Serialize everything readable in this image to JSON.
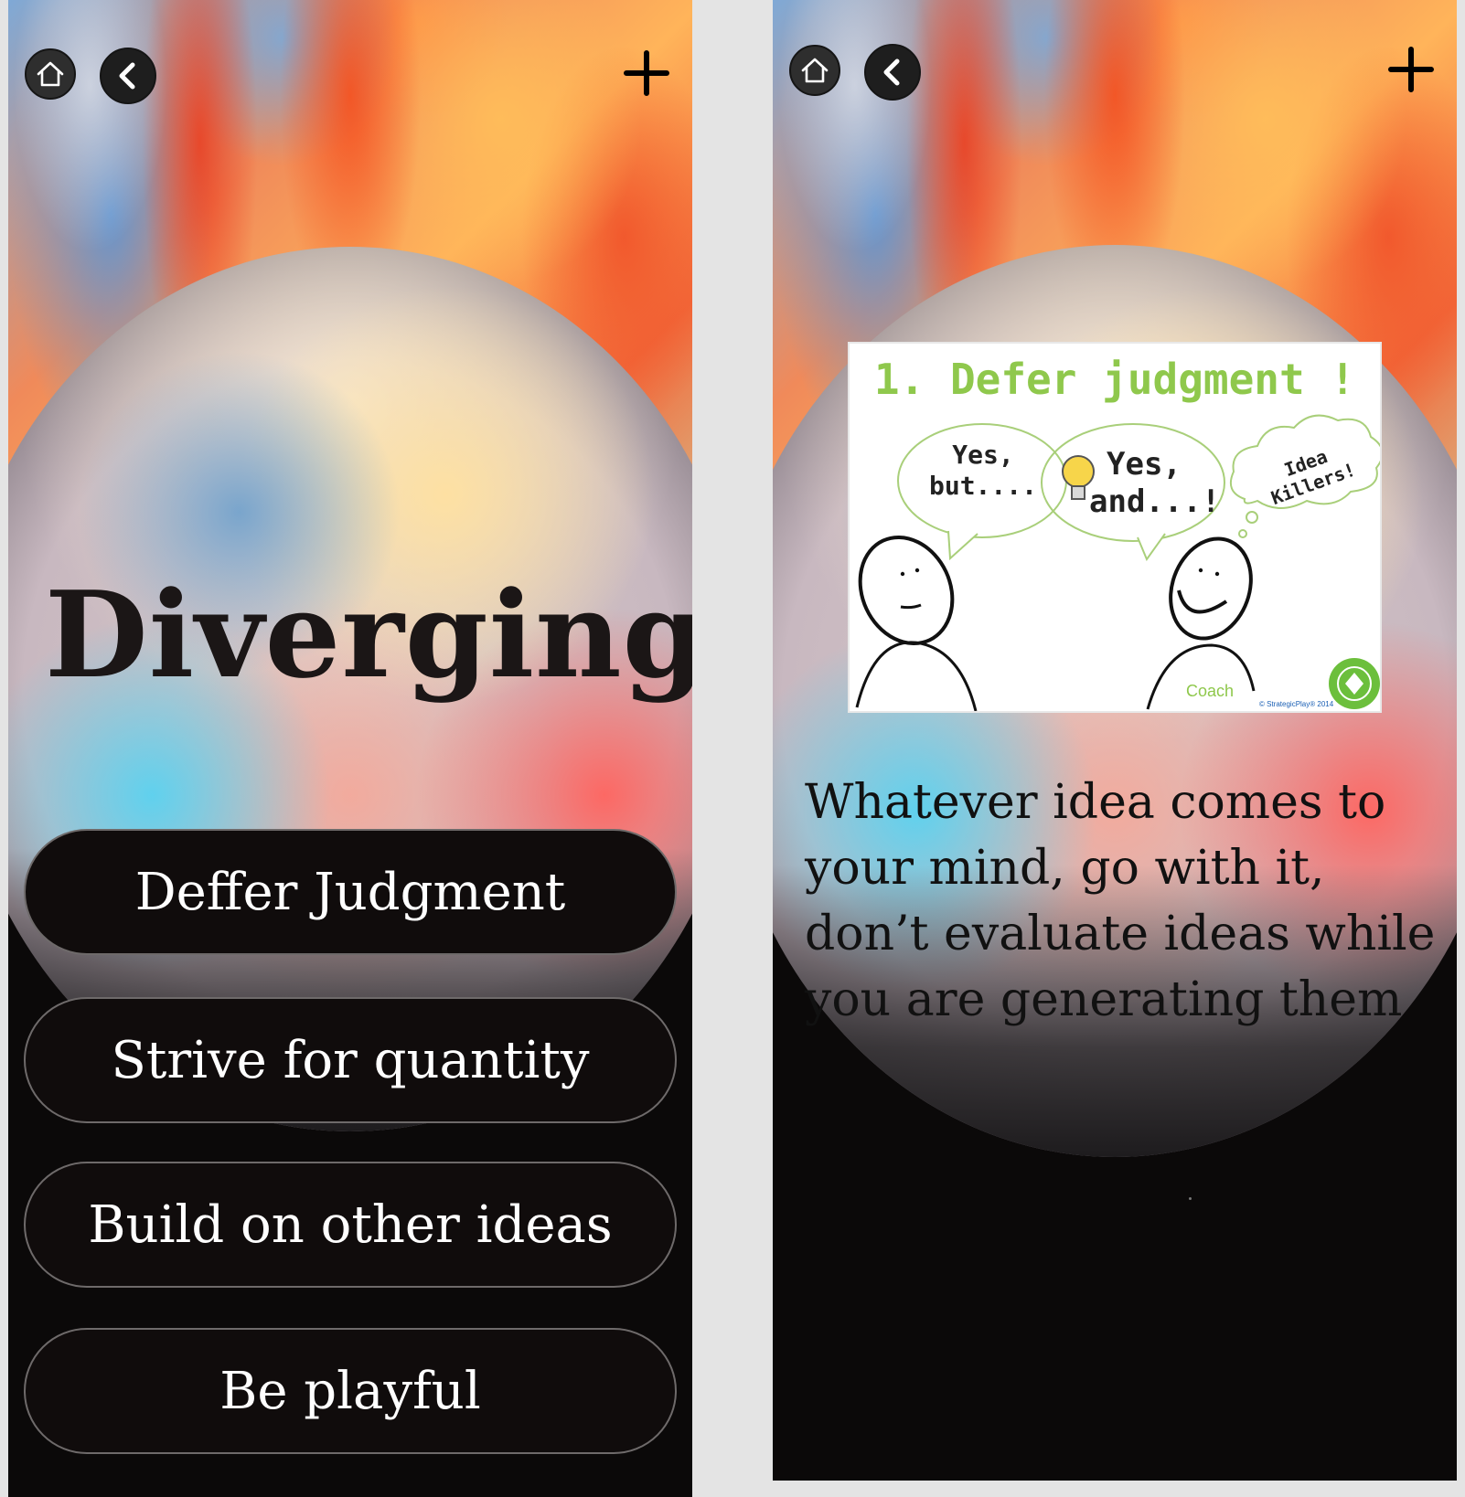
{
  "left_screen": {
    "title": "Diverging",
    "options": [
      {
        "label": "Deffer Judgment"
      },
      {
        "label": "Strive for quantity"
      },
      {
        "label": "Build on other ideas"
      },
      {
        "label": "Be playful"
      }
    ]
  },
  "right_screen": {
    "card": {
      "heading": "1. Defer judgment !",
      "bubble_left": "Yes, but....",
      "bubble_middle": "Yes, and...!",
      "thought_bubble": "Idea Killers!",
      "caption": "Coach",
      "copyright": "© StrategicPlay® 2014",
      "badge": "IDEA DIAMONDS"
    },
    "description": "Whatever idea comes to your mind, go with it, don’t evaluate ideas while you are generating them"
  },
  "icons": {
    "home": "home-icon",
    "back": "chevron-left-icon",
    "add": "plus-icon",
    "bulb": "lightbulb-icon"
  },
  "colors": {
    "pill_background": "#100c0c",
    "pill_border": "#6e6a6a",
    "card_heading": "#8fc84c"
  }
}
